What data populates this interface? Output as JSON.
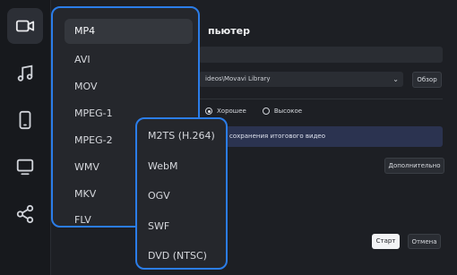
{
  "rail": {
    "items": [
      {
        "icon": "video-camera-icon",
        "active": true
      },
      {
        "icon": "music-note-icon",
        "active": false
      },
      {
        "icon": "mobile-phone-icon",
        "active": false
      },
      {
        "icon": "monitor-icon",
        "active": false
      },
      {
        "icon": "share-icon",
        "active": false
      }
    ]
  },
  "panel": {
    "title_fragment": "пьютер",
    "path_value": "ideos\\Movavi Library",
    "browse_label": "Обзор",
    "quality_good_label": "Хорошее",
    "quality_high_label": "Высокое",
    "info_text": "сохранения итогового видео",
    "advanced_label": "Дополнительно",
    "start_label": "Старт",
    "cancel_label": "Отмена"
  },
  "format_menu": {
    "items": [
      "MP4",
      "AVI",
      "MOV",
      "MPEG-1",
      "MPEG-2",
      "WMV",
      "MKV",
      "FLV"
    ],
    "selected": "MP4"
  },
  "format_submenu": {
    "items": [
      "M2TS (H.264)",
      "WebM",
      "OGV",
      "SWF",
      "DVD (NTSC)"
    ]
  },
  "colors": {
    "accent_border": "#2b7de9",
    "background": "#1d1f24",
    "menu_bg": "#25272c",
    "info_bg": "#2b3350"
  }
}
